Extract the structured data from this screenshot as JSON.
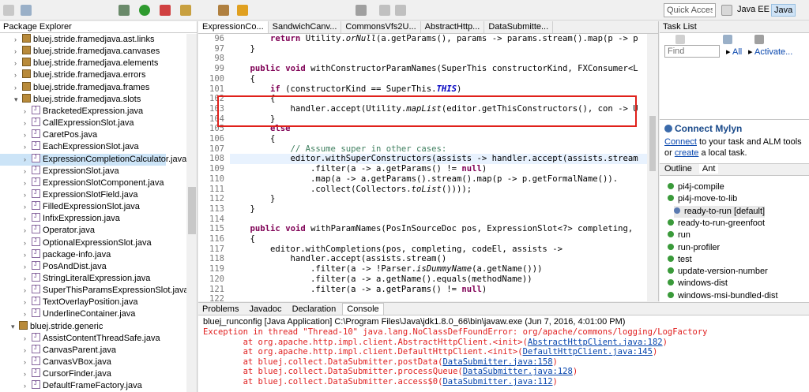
{
  "toolbar": {
    "quick_access": "Quick Access",
    "perspectives": [
      "Java EE",
      "Java"
    ]
  },
  "package_explorer": {
    "title": "Package Explorer",
    "rows": [
      {
        "label": "bluej.stride.framedjava.ast.links",
        "kind": "pkg",
        "expanded": false
      },
      {
        "label": "bluej.stride.framedjava.canvases",
        "kind": "pkg",
        "expanded": false
      },
      {
        "label": "bluej.stride.framedjava.elements",
        "kind": "pkg",
        "expanded": false
      },
      {
        "label": "bluej.stride.framedjava.errors",
        "kind": "pkg",
        "expanded": false
      },
      {
        "label": "bluej.stride.framedjava.frames",
        "kind": "pkg",
        "expanded": false
      },
      {
        "label": "bluej.stride.framedjava.slots",
        "kind": "pkg",
        "expanded": true
      },
      {
        "label": "BracketedExpression.java",
        "kind": "java"
      },
      {
        "label": "CallExpressionSlot.java",
        "kind": "java"
      },
      {
        "label": "CaretPos.java",
        "kind": "java"
      },
      {
        "label": "EachExpressionSlot.java",
        "kind": "java"
      },
      {
        "label": "ExpressionCompletionCalculator.java",
        "kind": "java",
        "selected": true
      },
      {
        "label": "ExpressionSlot.java",
        "kind": "java"
      },
      {
        "label": "ExpressionSlotComponent.java",
        "kind": "java"
      },
      {
        "label": "ExpressionSlotField.java",
        "kind": "java"
      },
      {
        "label": "FilledExpressionSlot.java",
        "kind": "java"
      },
      {
        "label": "InfixExpression.java",
        "kind": "java"
      },
      {
        "label": "Operator.java",
        "kind": "java"
      },
      {
        "label": "OptionalExpressionSlot.java",
        "kind": "java"
      },
      {
        "label": "package-info.java",
        "kind": "java"
      },
      {
        "label": "PosAndDist.java",
        "kind": "java"
      },
      {
        "label": "StringLiteralExpression.java",
        "kind": "java"
      },
      {
        "label": "SuperThisParamsExpressionSlot.java",
        "kind": "java"
      },
      {
        "label": "TextOverlayPosition.java",
        "kind": "java"
      },
      {
        "label": "UnderlineContainer.java",
        "kind": "java"
      },
      {
        "label": "bluej.stride.generic",
        "kind": "pkg",
        "expanded": true,
        "top_level": true
      },
      {
        "label": "AssistContentThreadSafe.java",
        "kind": "java"
      },
      {
        "label": "CanvasParent.java",
        "kind": "java"
      },
      {
        "label": "CanvasVBox.java",
        "kind": "java"
      },
      {
        "label": "CursorFinder.java",
        "kind": "java"
      },
      {
        "label": "DefaultFrameFactory.java",
        "kind": "java"
      }
    ]
  },
  "editor": {
    "tabs": [
      "ExpressionCo...",
      "SandwichCanv...",
      "CommonsVfs2U...",
      "AbstractHttp...",
      "DataSubmitte..."
    ],
    "line_numbers": [
      "96",
      "97",
      "98",
      "99",
      "100",
      "101",
      "102",
      "103",
      "104",
      "105",
      "106",
      "107",
      "108",
      "109",
      "110",
      "111",
      "112",
      "113",
      "114",
      "115",
      "116",
      "117",
      "118",
      "119",
      "120",
      "121",
      "122"
    ],
    "lines": [
      "        return Utility.orNull(a.getParams(), params -> params.stream().map(p -> p",
      "    }",
      "",
      "    public void withConstructorParamNames(SuperThis constructorKind, FXConsumer<L",
      "    {",
      "        if (constructorKind == SuperThis.THIS)",
      "        {",
      "            handler.accept(Utility.mapList(editor.getThisConstructors(), con -> U",
      "        }",
      "        else",
      "        {",
      "            // Assume super in other cases:",
      "            editor.withSuperConstructors(assists -> handler.accept(assists.stream",
      "                .filter(a -> a.getParams() != null)",
      "                .map(a -> a.getParams().stream().map(p -> p.getFormalName()).",
      "                .collect(Collectors.toList())));",
      "        }",
      "    }",
      "",
      "    public void withParamNames(PosInSourceDoc pos, ExpressionSlot<?> completing,",
      "    {",
      "        editor.withCompletions(pos, completing, codeEl, assists ->",
      "            handler.accept(assists.stream()",
      "                .filter(a -> !Parser.isDummyName(a.getName()))",
      "                .filter(a -> a.getName().equals(methodName))",
      "                .filter(a -> a.getParams() != null)",
      ""
    ]
  },
  "task_list": {
    "title": "Task List",
    "find_placeholder": "Find",
    "all_label": "All",
    "activate_label": "Activate..."
  },
  "mylyn": {
    "title": "Connect Mylyn",
    "connect_link": "Connect",
    "connect_rest": " to your task and ALM tools or",
    "create_link": "create",
    "create_rest": " a local task."
  },
  "ant": {
    "tabs": [
      "Outline",
      "Ant"
    ],
    "targets": [
      {
        "label": "pi4j-compile"
      },
      {
        "label": "pi4j-move-to-lib"
      },
      {
        "label": "ready-to-run [default]",
        "default": true
      },
      {
        "label": "ready-to-run-greenfoot"
      },
      {
        "label": "run"
      },
      {
        "label": "run-profiler"
      },
      {
        "label": "test"
      },
      {
        "label": "update-version-number"
      },
      {
        "label": "windows-dist"
      },
      {
        "label": "windows-msi-bundled-dist"
      }
    ]
  },
  "console": {
    "tabs": [
      "Problems",
      "Javadoc",
      "Declaration",
      "Console"
    ],
    "header": "bluej_runconfig [Java Application] C:\\Program Files\\Java\\jdk1.8.0_66\\bin\\javaw.exe (Jun 7, 2016, 4:01:00 PM)",
    "lines": [
      {
        "text": "Exception in thread \"Thread-10\" java.lang.NoClassDefFoundError: org/apache/commons/logging/LogFactory",
        "link": ""
      },
      {
        "text": "        at org.apache.http.impl.client.AbstractHttpClient.<init>(",
        "link": "AbstractHttpClient.java:182",
        "tail": ")"
      },
      {
        "text": "        at org.apache.http.impl.client.DefaultHttpClient.<init>(",
        "link": "DefaultHttpClient.java:145",
        "tail": ")"
      },
      {
        "text": "        at bluej.collect.DataSubmitter.postData(",
        "link": "DataSubmitter.java:158",
        "tail": ")"
      },
      {
        "text": "        at bluej.collect.DataSubmitter.processQueue(",
        "link": "DataSubmitter.java:128",
        "tail": ")"
      },
      {
        "text": "        at bluej.collect.DataSubmitter.access$0(",
        "link": "DataSubmitter.java:112",
        "tail": ")"
      }
    ]
  }
}
